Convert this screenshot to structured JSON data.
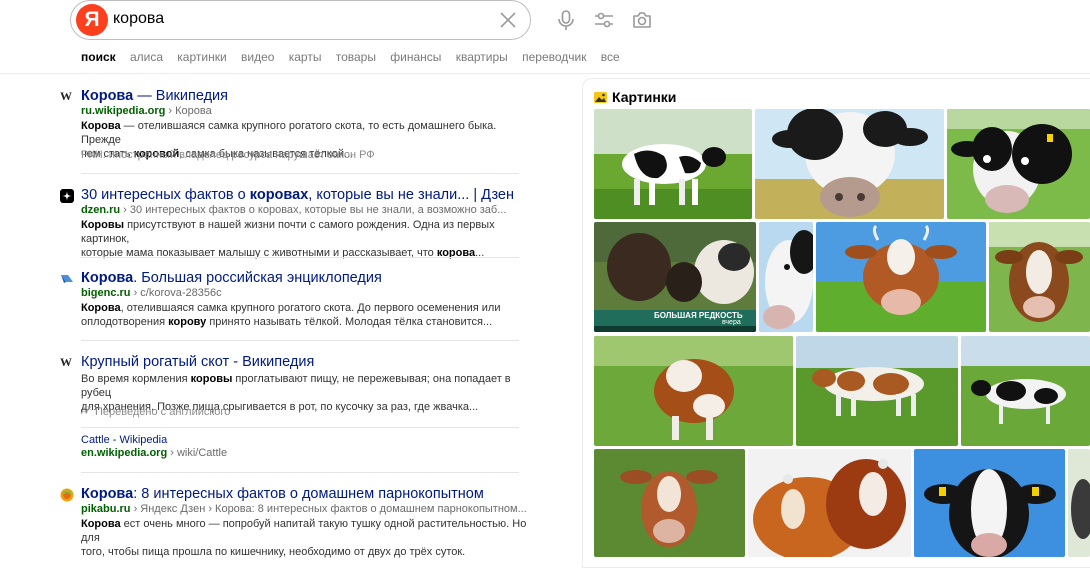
{
  "search": {
    "query": "корова",
    "logo_letter": "Я"
  },
  "tabs": [
    "поиск",
    "алиса",
    "картинки",
    "видео",
    "карты",
    "товары",
    "финансы",
    "квартиры",
    "переводчик",
    "все"
  ],
  "results": [
    {
      "title_bold": "Корова",
      "title_rest": " — Википедия",
      "host": "ru.wikipedia.org",
      "path": " › Корова",
      "snippet_line1_a": "Корова",
      "snippet_line1_b": " — отелившаяся самка крупного рогатого скота, то есть домашнего быка. Прежде",
      "snippet_line2_a": "чем стать ",
      "snippet_line2_b": "коровой",
      "snippet_line2_c": ", самка быка называется тёлкой...",
      "note": "РКН: иностранный владелец ресурса нарушает закон РФ"
    },
    {
      "title_a": "30 интересных фактов о ",
      "title_bold": "коровах",
      "title_rest": ", которые вы не знали... | Дзен",
      "host": "dzen.ru",
      "path": " › 30 интересных фактов о коровах, которые вы не знали, а возможно заб...",
      "snippet_line1_a": "Коровы",
      "snippet_line1_b": " присутствуют в нашей жизни почти с самого рождения. Одна из первых картинок,",
      "snippet_line2_a": "которые мама показывает малышу с животными и рассказывает, что ",
      "snippet_line2_b": "корова",
      "snippet_line2_c": "..."
    },
    {
      "title_bold": "Корова",
      "title_rest": ". Большая российская энциклопедия",
      "host": "bigenc.ru",
      "path": " › c/korova-28356c",
      "snippet_line1_a": "Корова",
      "snippet_line1_b": ", отелившаяся самка крупного рогатого скота. До первого осеменения или",
      "snippet_line2_a": "оплодотворения ",
      "snippet_line2_b": "корову",
      "snippet_line2_c": " принято называть тёлкой. Молодая тёлка становится..."
    },
    {
      "title_rest": "Крупный рогатый скот - Википедия",
      "snippet_line1_a": "Во время кормления ",
      "snippet_line1_b": "коровы",
      "snippet_line1_c": " проглатывают пищу, не пережевывая; она попадает в рубец",
      "snippet_line2_a": "для хранения. Позже пища срыгивается в рот, по кусочку за раз, где жвачка...",
      "note": "Переведено с английского",
      "sub_title": "Cattle - Wikipedia",
      "sub_host": "en.wikipedia.org",
      "sub_path": " › wiki/Cattle"
    },
    {
      "title_bold": "Корова",
      "title_rest": ": 8 интересных фактов о домашнем парнокопытном",
      "host": "pikabu.ru",
      "path": " › Яндекс Дзен › Корова: 8 интересных фактов о домашнем парнокопытном...",
      "snippet_line1_a": "Корова",
      "snippet_line1_b": " ест очень много — попробуй напитай такую тушку одной растительностью. Но для",
      "snippet_line2_a": "того, чтобы пища прошла по кишечнику, необходимо от двух до трёх суток."
    }
  ],
  "images": {
    "heading": "Картинки",
    "caption_news": "БОЛЬШАЯ РЕДКОСТЬ",
    "caption_time": "вчера"
  },
  "icons": {
    "favicon_1": "wikipedia-w-icon",
    "favicon_2": "dzen-icon",
    "favicon_3": "bigenc-icon",
    "favicon_4": "wikipedia-w-icon",
    "favicon_5": "pikabu-icon"
  },
  "colors": {
    "title": "#001a80",
    "host": "#006000",
    "logo": "#fc3f1d"
  }
}
